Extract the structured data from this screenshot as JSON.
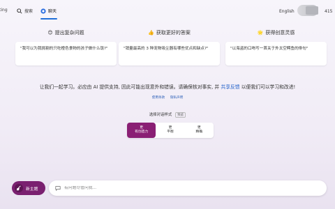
{
  "topbar": {
    "tabs": [
      {
        "label": "ting"
      },
      {
        "label": "搜索"
      },
      {
        "label": "聊天"
      }
    ],
    "language": "English",
    "count": "415"
  },
  "columns": [
    {
      "icon": "😊",
      "title": "提出复杂问题",
      "example": "\"我可以为我挑剔的只吃橙色食物的孩子做什么饭?\""
    },
    {
      "icon": "👍",
      "title": "获取更好的答案",
      "example": "\"销量最高的 3 种宠物吸尘器有哪些优点和缺点?\""
    },
    {
      "icon": "🌟",
      "title": "获得创意灵感",
      "example": "\"以海盗的口吻写一首关于外太空鳄鱼的俳句\""
    }
  ],
  "notice": {
    "text_before": "让我们一起学习。必应由 AI 提供支持, 因此可能出现意外和错误。请确保核对事实, 并",
    "link": "共享反馈",
    "text_after": "以便我们可以学习和改进!"
  },
  "links": {
    "terms": "使用条款",
    "privacy": "隐私声明"
  },
  "style_selector": {
    "label": "选择对话样式",
    "badge": "预览",
    "options": [
      {
        "top": "更",
        "bottom": "有创造力",
        "selected": true
      },
      {
        "top": "更",
        "bottom": "平衡",
        "selected": false
      },
      {
        "top": "更",
        "bottom": "精确",
        "selected": false
      }
    ]
  },
  "composer": {
    "new_topic": "新主题",
    "placeholder": "有问题尽管问我..."
  }
}
